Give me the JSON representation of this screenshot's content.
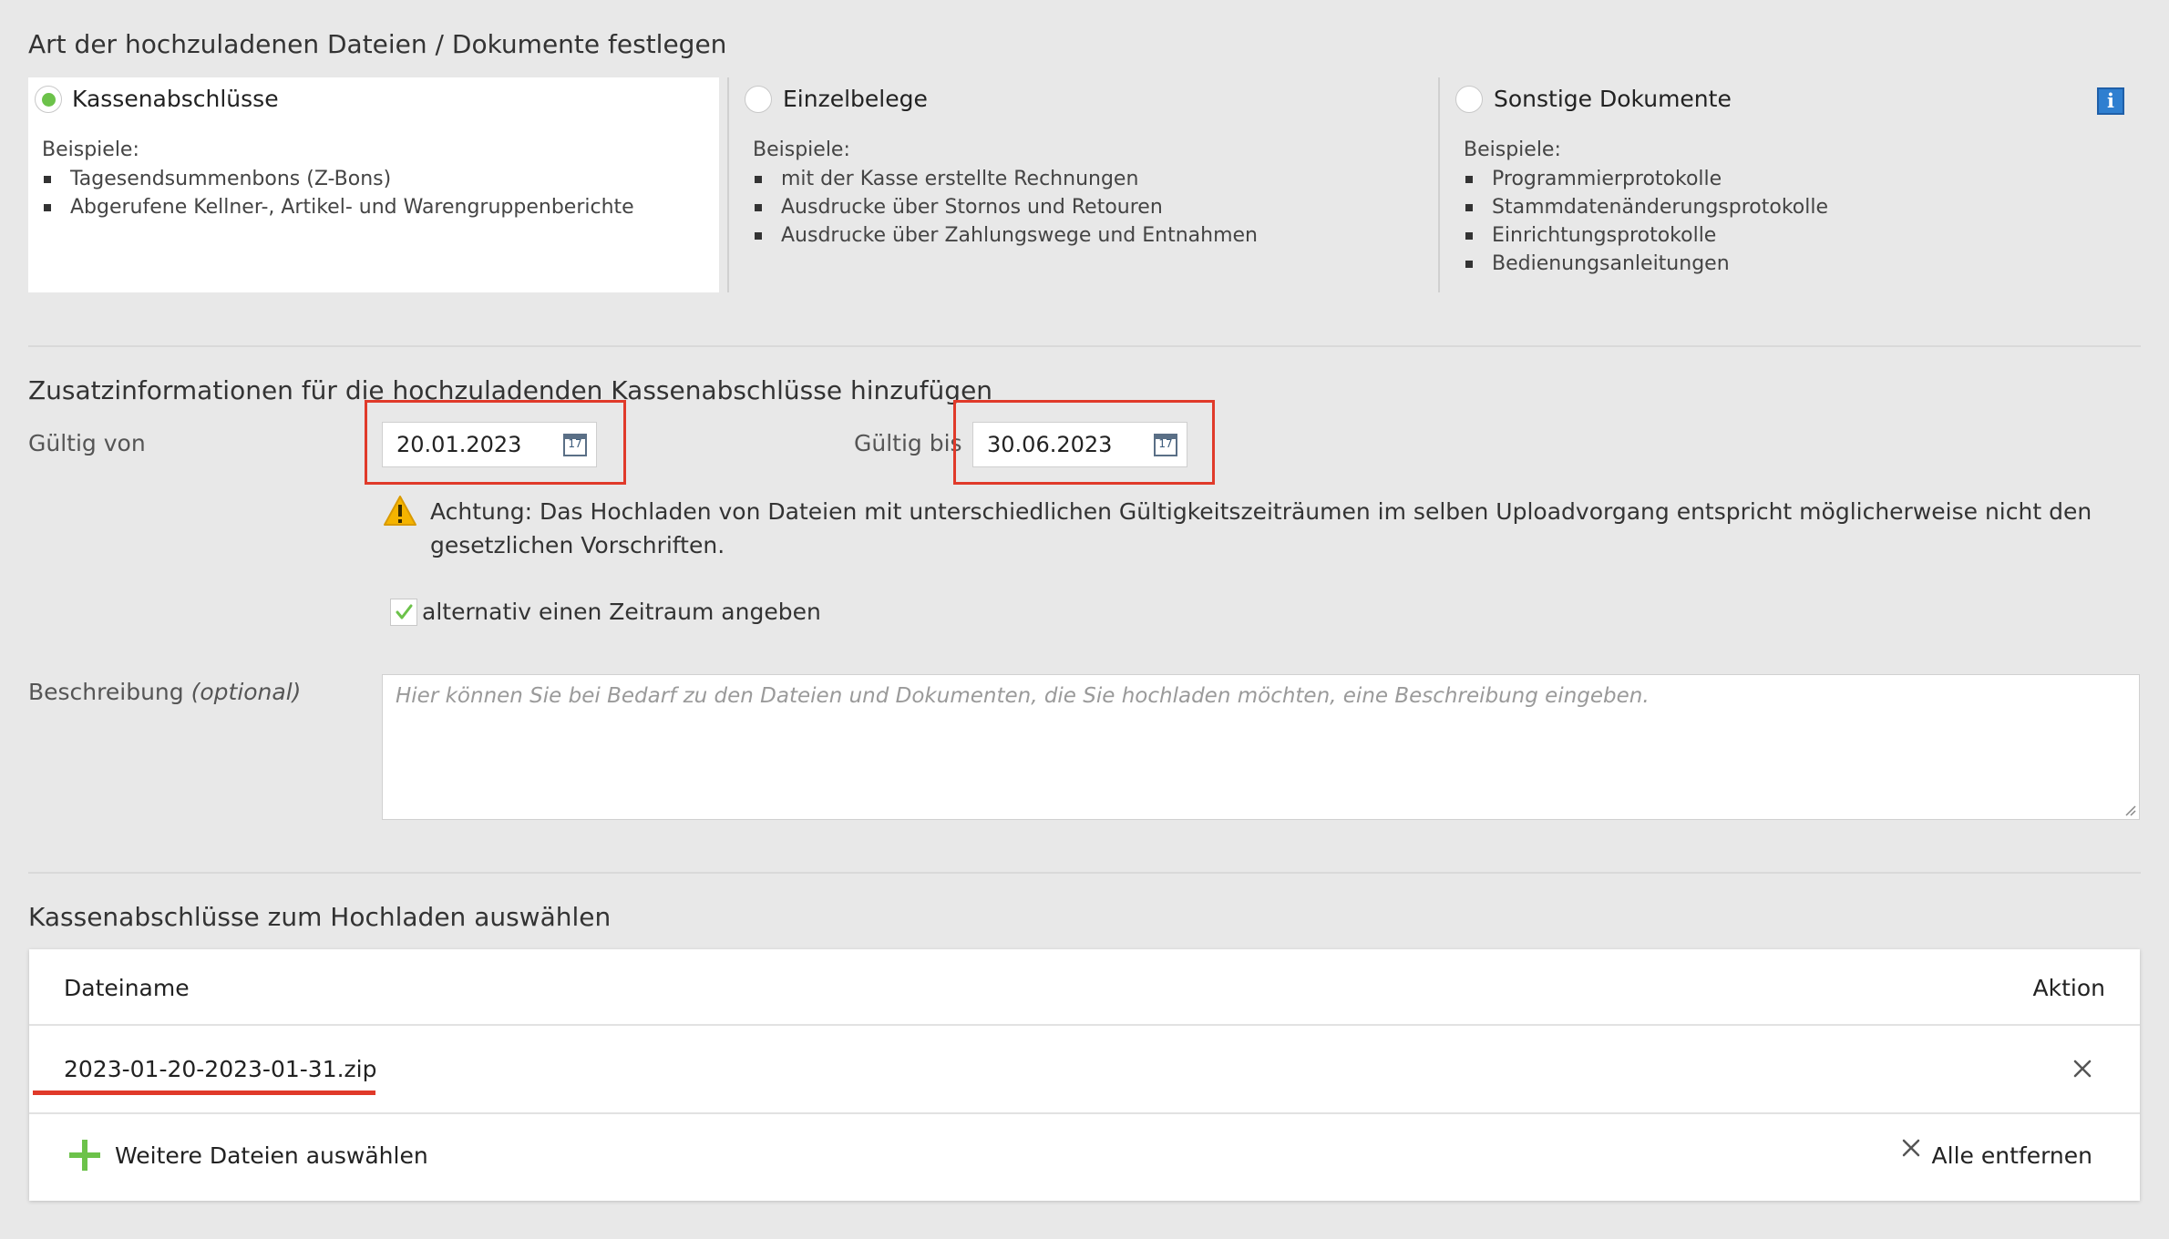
{
  "type_section": {
    "title": "Art der hochzuladenen Dateien / Dokumente festlegen",
    "examples_label": "Beispiele:",
    "options": [
      {
        "label": "Kassenabschlüsse",
        "selected": true,
        "examples": [
          "Tagesendsummenbons (Z-Bons)",
          "Abgerufene Kellner-, Artikel- und Warengruppenberichte"
        ]
      },
      {
        "label": "Einzelbelege",
        "selected": false,
        "examples": [
          "mit der Kasse erstellte Rechnungen",
          "Ausdrucke über Stornos und Retouren",
          "Ausdrucke über Zahlungswege und Entnahmen"
        ]
      },
      {
        "label": "Sonstige Dokumente",
        "selected": false,
        "examples": [
          "Programmierprotokolle",
          "Stammdatenänderungsprotokolle",
          "Einrichtungsprotokolle",
          "Bedienungsanleitungen"
        ]
      }
    ],
    "info_icon": "info-icon",
    "info_glyph": "i"
  },
  "extra_section": {
    "title": "Zusatzinformationen für die hochzuladenden Kassenabschlüsse hinzufügen",
    "valid_from_label": "Gültig von",
    "valid_from_value": "20.01.2023",
    "valid_to_label": "Gültig bis",
    "valid_to_value": "30.06.2023",
    "calendar_icon": "calendar-icon",
    "calendar_glyph": "17",
    "warning_text": "Achtung: Das Hochladen von Dateien mit unterschiedlichen Gültigkeitszeiträumen im selben Uploadvorgang entspricht möglicherweise nicht den gesetzlichen Vorschriften.",
    "alt_period_label": "alternativ einen Zeitraum angeben",
    "alt_period_checked": true,
    "description_label": "Beschreibung",
    "description_optional": "(optional)",
    "description_placeholder": "Hier können Sie bei Bedarf zu den Dateien und Dokumenten, die Sie hochladen möchten, eine Beschreibung eingeben."
  },
  "upload_section": {
    "title": "Kassenabschlüsse zum Hochladen auswählen",
    "col_filename": "Dateiname",
    "col_action": "Aktion",
    "files": [
      "2023-01-20-2023-01-31.zip"
    ],
    "add_more_label": "Weitere Dateien auswählen",
    "remove_all_label": "Alle entfernen"
  },
  "colors": {
    "accent_green": "#6cc24a",
    "highlight_red": "#e03a2a",
    "info_blue": "#2f7fd0"
  }
}
